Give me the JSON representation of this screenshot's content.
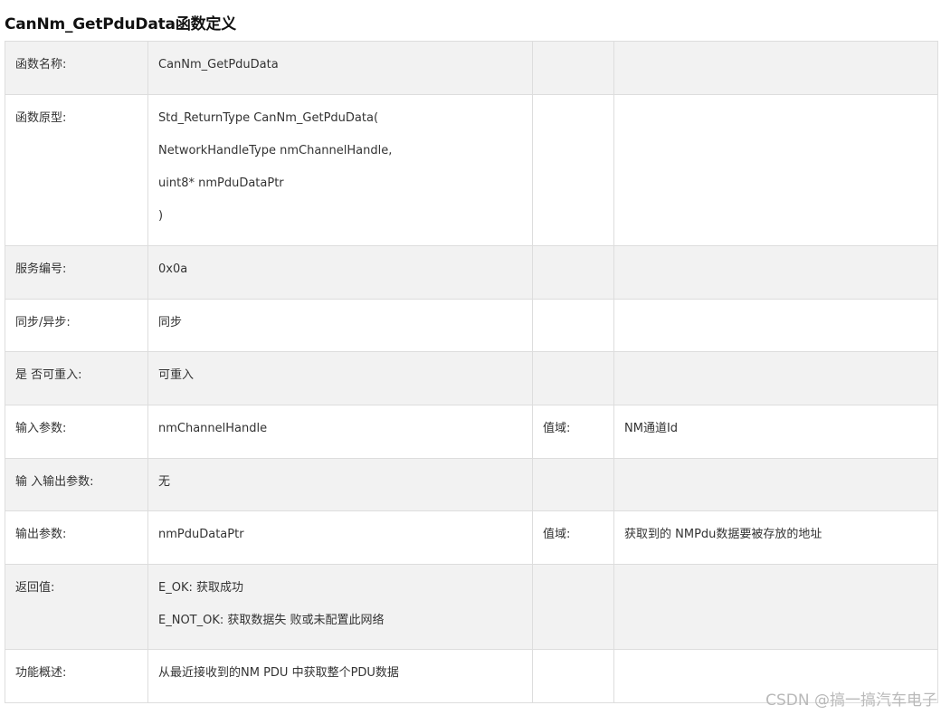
{
  "title": "CanNm_GetPduData函数定义",
  "rows": [
    {
      "label": "函数名称:",
      "value": [
        "CanNm_GetPduData"
      ],
      "range_label": "",
      "range_value": ""
    },
    {
      "label": "函数原型:",
      "value": [
        "Std_ReturnType CanNm_GetPduData(",
        "NetworkHandleType nmChannelHandle,",
        "uint8* nmPduDataPtr",
        ")"
      ],
      "range_label": "",
      "range_value": ""
    },
    {
      "label": "服务编号:",
      "value": [
        "0x0a"
      ],
      "range_label": "",
      "range_value": ""
    },
    {
      "label": "同步/异步:",
      "value": [
        "同步"
      ],
      "range_label": "",
      "range_value": ""
    },
    {
      "label": "是 否可重入:",
      "value": [
        "可重入"
      ],
      "range_label": "",
      "range_value": ""
    },
    {
      "label": "输入参数:",
      "value": [
        "nmChannelHandle"
      ],
      "range_label": "值域:",
      "range_value": "NM通道Id"
    },
    {
      "label": "输 入输出参数:",
      "value": [
        "无"
      ],
      "range_label": "",
      "range_value": ""
    },
    {
      "label": "输出参数:",
      "value": [
        "nmPduDataPtr"
      ],
      "range_label": "值域:",
      "range_value": "获取到的 NMPdu数据要被存放的地址"
    },
    {
      "label": "返回值:",
      "value": [
        "E_OK: 获取成功",
        "E_NOT_OK: 获取数据失 败或未配置此网络"
      ],
      "range_label": "",
      "range_value": ""
    },
    {
      "label": "功能概述:",
      "value": [
        "从最近接收到的NM PDU 中获取整个PDU数据"
      ],
      "range_label": "",
      "range_value": ""
    }
  ],
  "watermark": "CSDN @搞一搞汽车电子"
}
